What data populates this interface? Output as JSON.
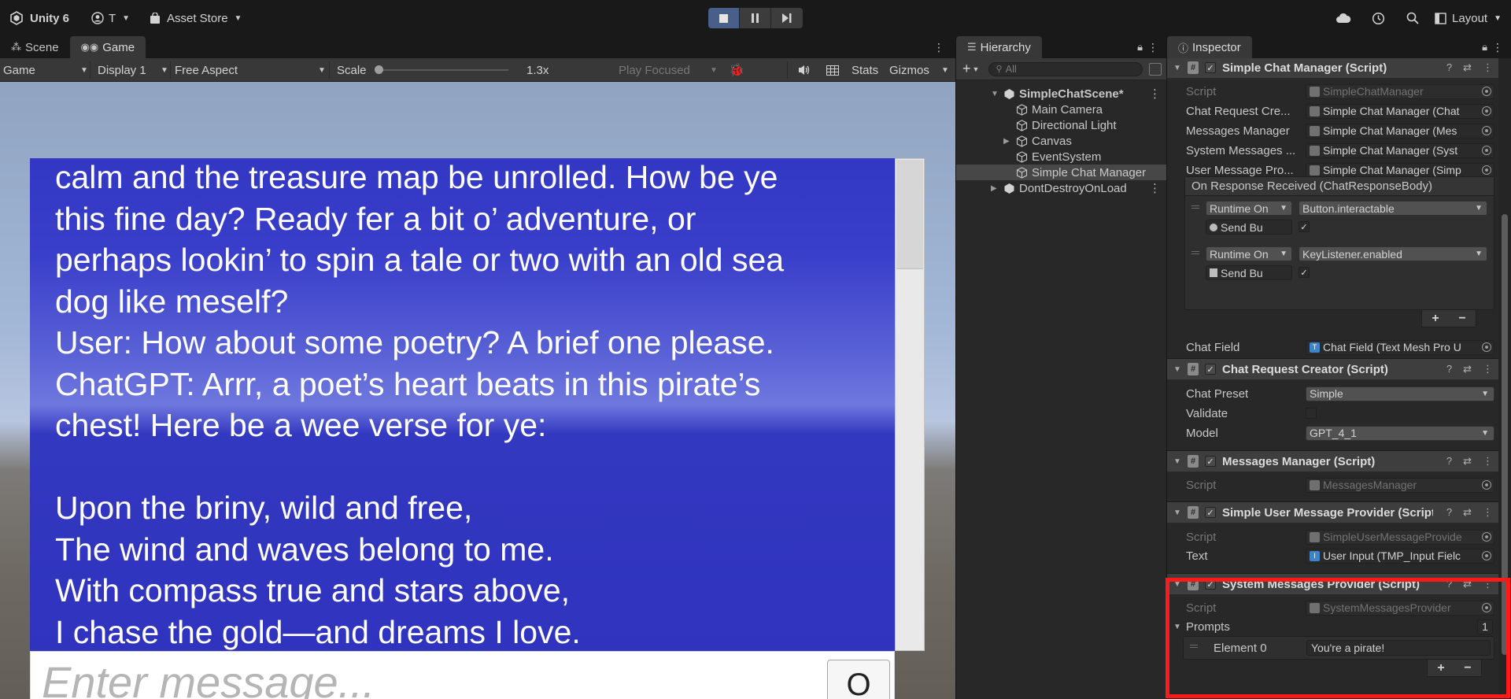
{
  "topbar": {
    "product": "Unity 6",
    "account": "T",
    "asset_store": "Asset Store",
    "layout": "Layout",
    "icons": [
      "unity-logo-icon",
      "account-icon",
      "shopping-bag-icon",
      "stop-icon",
      "pause-icon",
      "step-icon",
      "cloud-icon",
      "history-icon",
      "search-icon",
      "layout-icon"
    ]
  },
  "game_panel": {
    "tabs": [
      {
        "label": "Scene",
        "icon": "scene-icon"
      },
      {
        "label": "Game",
        "icon": "game-controller-icon"
      }
    ],
    "toolbar": {
      "view_mode": "Game",
      "display": "Display 1",
      "aspect": "Free Aspect",
      "scale_label": "Scale",
      "scale_value": "1.3x",
      "scale_fraction": 0.0,
      "play_focused": "Play Focused",
      "stats": "Stats",
      "gizmos": "Gizmos"
    },
    "chat": {
      "transcript": "calm and the treasure map be unrolled. How be ye\nthis fine day? Ready fer a bit o’ adventure, or\nperhaps lookin’ to spin a tale or two with an old sea\ndog like meself?\nUser: How about some poetry? A brief one please.\nChatGPT: Arrr, a poet’s heart beats in this pirate’s\nchest! Here be a wee verse for ye:\n\nUpon the briny, wild and free,\nThe wind and waves belong to me.\nWith compass true and stars above,\nI chase the gold—and dreams I love.",
      "input_placeholder": "Enter message...",
      "send_label": "O"
    }
  },
  "hierarchy": {
    "tab": "Hierarchy",
    "search_placeholder": "All",
    "items": [
      {
        "label": "SimpleChatScene*"
      },
      {
        "label": "Main Camera"
      },
      {
        "label": "Directional Light"
      },
      {
        "label": "Canvas"
      },
      {
        "label": "EventSystem"
      },
      {
        "label": "Simple Chat Manager"
      },
      {
        "label": "DontDestroyOnLoad"
      }
    ]
  },
  "inspector": {
    "tab": "Inspector",
    "simple_chat_manager": {
      "title": "Simple Chat Manager (Script)",
      "script_label": "Script",
      "script_value": "SimpleChatManager",
      "chat_request_label": "Chat Request Cre...",
      "chat_request_value": "Simple Chat Manager (Chat",
      "messages_manager_label": "Messages Manager",
      "messages_manager_value": "Simple Chat Manager (Mes",
      "system_messages_label": "System Messages ...",
      "system_messages_value": "Simple Chat Manager (Syst",
      "user_message_label": "User Message Pro...",
      "user_message_value": "Simple Chat Manager (Simp",
      "event_title": "On Response Received (ChatResponseBody)",
      "event_rows": [
        {
          "mode": "Runtime On",
          "function": "Button.interactable",
          "target": "Send Bu"
        },
        {
          "mode": "Runtime On",
          "function": "KeyListener.enabled",
          "target": "Send Bu"
        }
      ],
      "chat_field_label": "Chat Field",
      "chat_field_value": "Chat Field (Text Mesh Pro U"
    },
    "chat_request_creator": {
      "title": "Chat Request Creator (Script)",
      "preset_label": "Chat Preset",
      "preset_value": "Simple",
      "validate_label": "Validate",
      "model_label": "Model",
      "model_value": "GPT_4_1"
    },
    "messages_manager": {
      "title": "Messages Manager (Script)",
      "script_label": "Script",
      "script_value": "MessagesManager"
    },
    "simple_user_message_provider": {
      "title": "Simple User Message Provider (Script)",
      "script_label": "Script",
      "script_value": "SimpleUserMessageProvide",
      "text_label": "Text",
      "text_value": "User Input (TMP_Input Fielc"
    },
    "system_messages_provider": {
      "title": "System Messages Provider (Script)",
      "script_label": "Script",
      "script_value": "SystemMessagesProvider",
      "prompts_label": "Prompts",
      "prompts_count": "1",
      "element_label": "Element 0",
      "element_value": "You're a pirate!"
    }
  },
  "colors": {
    "highlight": "#ff1a1a",
    "chat_bg": "#3237c4",
    "accent": "#3d84c8"
  }
}
